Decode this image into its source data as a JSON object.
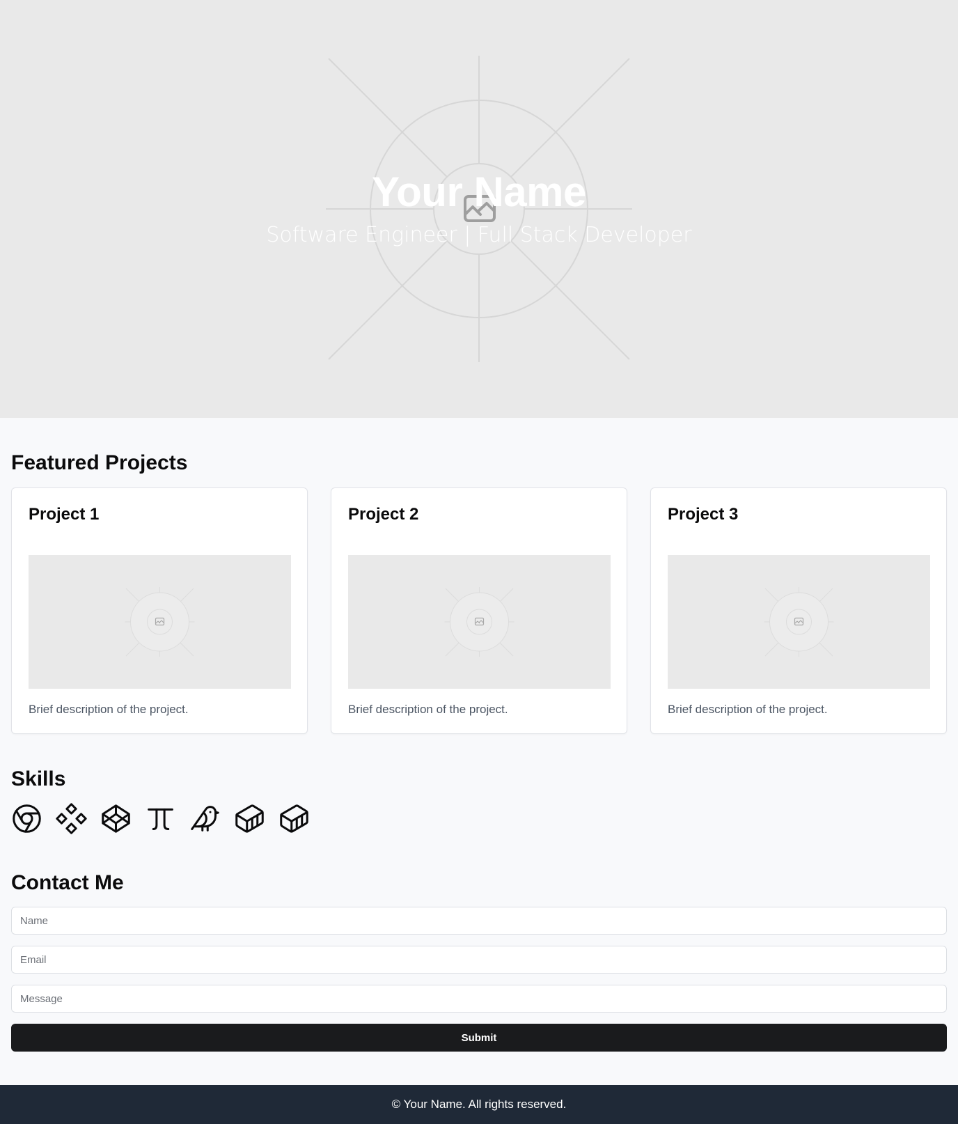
{
  "hero": {
    "title": "Your Name",
    "subtitle": "Software Engineer | Full Stack Developer",
    "background_color": "#e9e9e9"
  },
  "projects": {
    "heading": "Featured Projects",
    "items": [
      {
        "title": "Project 1",
        "description": "Brief description of the project."
      },
      {
        "title": "Project 2",
        "description": "Brief description of the project."
      },
      {
        "title": "Project 3",
        "description": "Brief description of the project."
      }
    ]
  },
  "skills": {
    "heading": "Skills",
    "icons": [
      "chrome-icon",
      "figma-icon",
      "codepen-icon",
      "pi-icon",
      "bird-icon",
      "container-icon",
      "container-icon"
    ]
  },
  "contact": {
    "heading": "Contact Me",
    "name_placeholder": "Name",
    "email_placeholder": "Email",
    "message_placeholder": "Message",
    "submit_label": "Submit"
  },
  "footer": {
    "text": "© Your Name. All rights reserved.",
    "background_color": "#1f2937"
  }
}
